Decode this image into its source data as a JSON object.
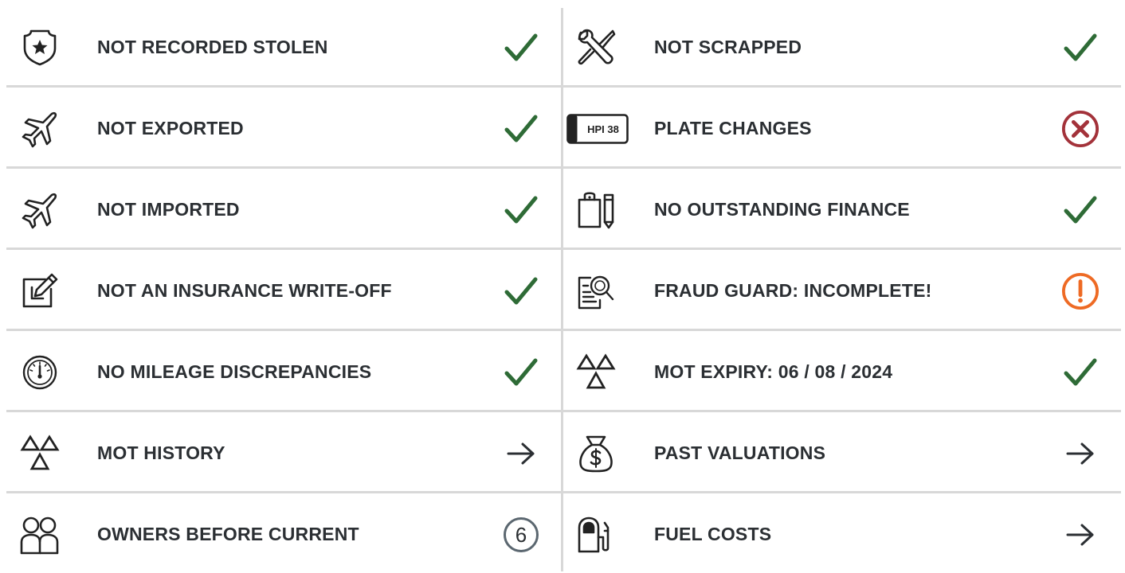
{
  "colors": {
    "ok": "#2e6b36",
    "fail": "#a3323a",
    "warn": "#ee6a24",
    "icon": "#222222",
    "divider": "#d8d8d8"
  },
  "left": [
    {
      "label": "NOT RECORDED STOLEN",
      "icon": "police-badge-icon",
      "status": "check"
    },
    {
      "label": "NOT EXPORTED",
      "icon": "plane-icon",
      "status": "check"
    },
    {
      "label": "NOT IMPORTED",
      "icon": "plane-icon",
      "status": "check"
    },
    {
      "label": "NOT AN INSURANCE WRITE-OFF",
      "icon": "edit-document-icon",
      "status": "check"
    },
    {
      "label": "NO MILEAGE DISCREPANCIES",
      "icon": "speedometer-icon",
      "status": "check"
    },
    {
      "label": "MOT HISTORY",
      "icon": "mot-triangles-icon",
      "status": "arrow"
    },
    {
      "label": "OWNERS BEFORE CURRENT",
      "icon": "owners-icon",
      "status": "count",
      "count": "6"
    }
  ],
  "right": [
    {
      "label": "NOT SCRAPPED",
      "icon": "tools-icon",
      "status": "check"
    },
    {
      "label": "PLATE CHANGES",
      "icon": "number-plate-icon",
      "plate_text": "HPI 38",
      "status": "cross"
    },
    {
      "label": "NO OUTSTANDING FINANCE",
      "icon": "clipboard-pen-icon",
      "status": "check"
    },
    {
      "label": "FRAUD GUARD: INCOMPLETE!",
      "icon": "document-search-icon",
      "status": "warning"
    },
    {
      "label": "MOT EXPIRY: 06 / 08 / 2024",
      "icon": "mot-triangles-icon",
      "status": "check"
    },
    {
      "label": "PAST VALUATIONS",
      "icon": "money-bag-icon",
      "status": "arrow"
    },
    {
      "label": "FUEL COSTS",
      "icon": "fuel-pump-icon",
      "status": "arrow"
    }
  ]
}
